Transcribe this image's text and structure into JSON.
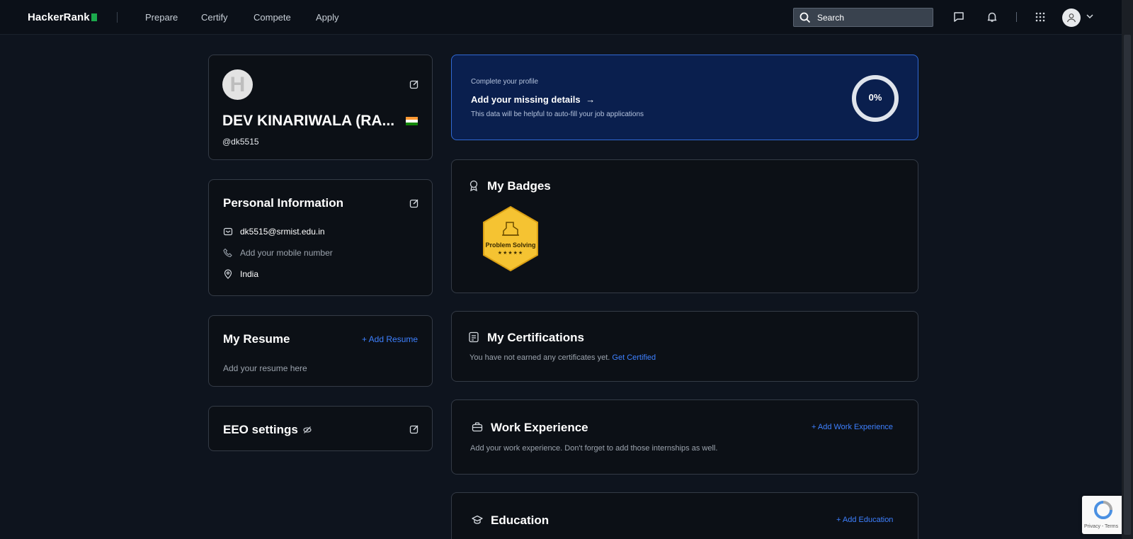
{
  "nav": {
    "logo": "HackerRank",
    "links": [
      "Prepare",
      "Certify",
      "Compete",
      "Apply"
    ],
    "search_placeholder": "Search",
    "icons": [
      "chat-icon",
      "bell-icon",
      "apps-grid-icon",
      "user-avatar-icon",
      "chevron-down-icon"
    ]
  },
  "profile": {
    "avatar_letter": "H",
    "name": "DEV KINARIWALA (RA...",
    "handle": "@dk5515",
    "country_flag": "India"
  },
  "personal_info": {
    "title": "Personal Information",
    "email": "dk5515@srmist.edu.in",
    "phone_placeholder": "Add your mobile number",
    "location": "India"
  },
  "resume": {
    "title": "My Resume",
    "add_label": "+ Add Resume",
    "placeholder": "Add your resume here"
  },
  "eeo": {
    "title": "EEO settings"
  },
  "complete_profile": {
    "kicker": "Complete your profile",
    "headline": "Add your missing details",
    "arrow": "→",
    "description": "This data will be helpful to auto-fill your job applications",
    "percent": "0%",
    "progress": 0
  },
  "badges": {
    "title": "My Badges",
    "items": [
      {
        "name": "Problem Solving",
        "stars": "★★★★★",
        "color": "#f5c332"
      }
    ]
  },
  "certifications": {
    "title": "My Certifications",
    "empty_text": "You have not earned any certificates yet.",
    "link": "Get Certified"
  },
  "work": {
    "title": "Work Experience",
    "add_label": "+ Add Work Experience",
    "placeholder": "Add your work experience. Don't forget to add those internships as well."
  },
  "education": {
    "title": "Education",
    "add_label": "+ Add Education"
  },
  "recaptcha": {
    "text": "Privacy - Terms"
  },
  "colors": {
    "background": "#0e141e",
    "card_border": "#343b46",
    "link_blue": "#3e80ff",
    "brand_green": "#1ba94c",
    "complete_bg": "#0a1f4e"
  }
}
